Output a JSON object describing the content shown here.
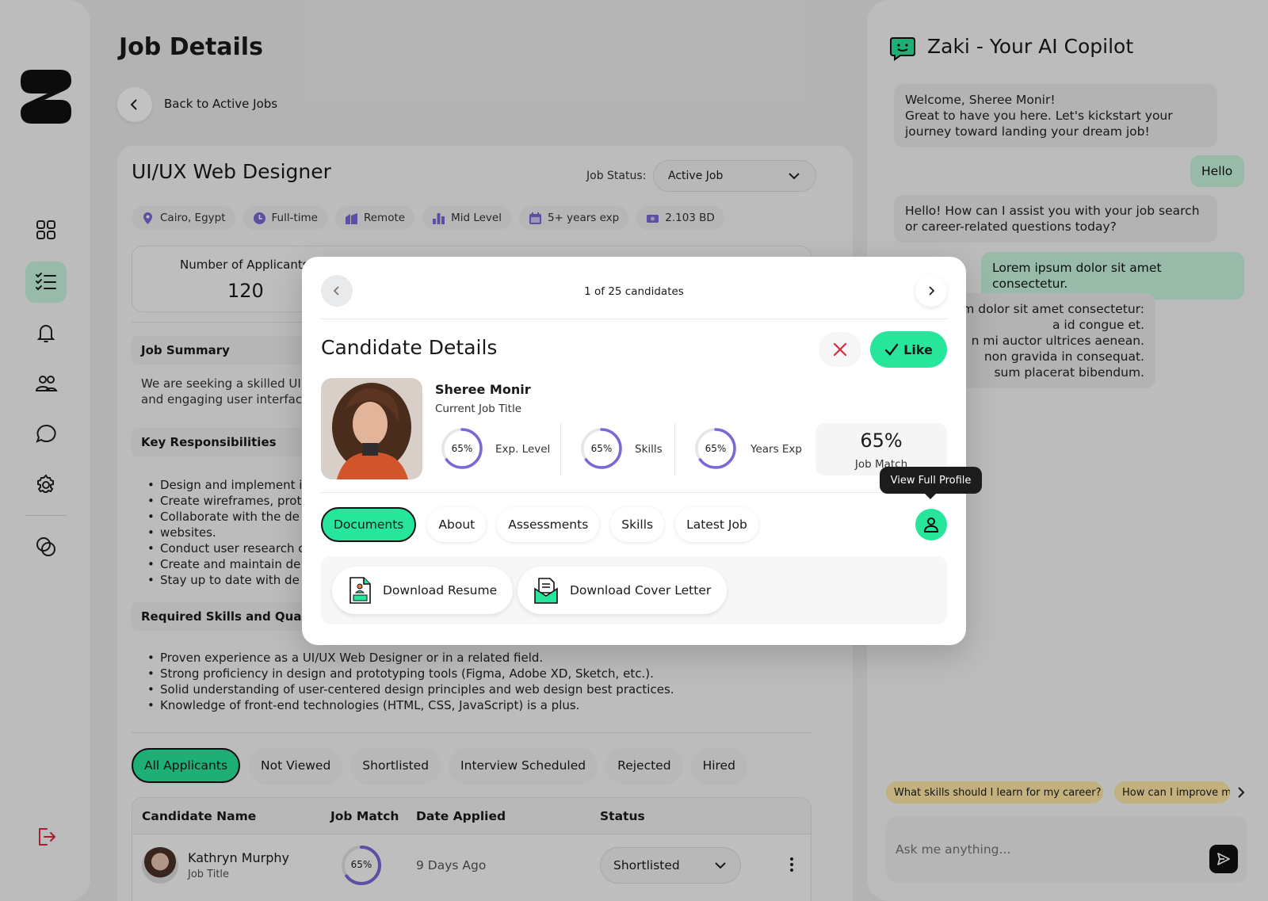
{
  "main": {
    "page_title": "Job Details",
    "back_label": "Back to Active Jobs",
    "job": {
      "title": "UI/UX Web Designer",
      "status_label": "Job Status:",
      "status_value": "Active Job",
      "chips": [
        {
          "icon": "location-pin-icon",
          "label": "Cairo, Egypt"
        },
        {
          "icon": "clock-icon",
          "label": "Full-time"
        },
        {
          "icon": "building-icon",
          "label": "Remote"
        },
        {
          "icon": "bar-chart-icon",
          "label": "Mid Level"
        },
        {
          "icon": "calendar-icon",
          "label": "5+ years exp"
        },
        {
          "icon": "money-icon",
          "label": "2.103 BD"
        }
      ],
      "applicants_label": "Number of Applicants",
      "applicants_value": "120",
      "summary_heading": "Job Summary",
      "summary_lines": [
        "We are seeking a skilled UI",
        "and engaging user interfac"
      ],
      "resp_heading": "Key Responsibilities",
      "responsibilities": [
        "Design and implement i",
        "Create wireframes, prot",
        "Collaborate with the de",
        "websites.",
        "Conduct user research c",
        "Create and maintain de",
        "Stay up to date with de"
      ],
      "skills_heading": "Required Skills and Qualif",
      "skills": [
        "Proven experience as a UI/UX Web Designer or in a related field.",
        "Strong proficiency in design and prototyping tools (Figma, Adobe XD, Sketch, etc.).",
        "Solid understanding of user-centered design principles and web design best practices.",
        "Knowledge of front-end technologies (HTML, CSS, JavaScript) is a plus."
      ]
    },
    "filters": [
      "All Applicants",
      "Not Viewed",
      "Shortlisted",
      "Interview Scheduled",
      "Rejected",
      "Hired"
    ],
    "table": {
      "headers": [
        "Candidate Name",
        "Job Match",
        "Date Applied",
        "Status"
      ],
      "rows": [
        {
          "name": "Kathryn Murphy",
          "subtitle": "Job Title",
          "match": "65%",
          "match_value": 0.65,
          "date": "9 Days Ago",
          "status": "Shortlisted"
        }
      ]
    }
  },
  "chat": {
    "title": "Zaki - Your AI Copilot",
    "messages": [
      {
        "from": "bot",
        "text": "Welcome, Sheree Monir!\nGreat to have you here. Let's kickstart your journey toward landing your dream job!"
      },
      {
        "from": "user",
        "text": "Hello"
      },
      {
        "from": "bot",
        "text": "Hello! How can I assist you with your job search or career-related questions today?"
      },
      {
        "from": "user",
        "text": "Lorem ipsum dolor sit amet consectetur."
      },
      {
        "from": "bot",
        "text": "um dolor sit amet consectetur:\na id congue et.\nn mi auctor ultrices aenean.\nnon gravida in consequat.\nsum placerat bibendum."
      }
    ],
    "suggestions": [
      "What skills should I learn for my career?",
      "How can I improve my"
    ],
    "input_placeholder": "Ask me anything..."
  },
  "modal": {
    "counter": "1 of 25 candidates",
    "title": "Candidate Details",
    "like_label": "Like",
    "candidate": {
      "name": "Sheree Monir",
      "job_title": "Current Job Title",
      "metrics": [
        {
          "pct": "65%",
          "value": 0.65,
          "label": "Exp. Level"
        },
        {
          "pct": "65%",
          "value": 0.65,
          "label": "Skills"
        },
        {
          "pct": "65%",
          "value": 0.65,
          "label": "Years Exp"
        }
      ],
      "job_match_value": "65%",
      "job_match_label": "Job Match"
    },
    "tooltip": "View Full Profile",
    "tabs": [
      "Documents",
      "About",
      "Assessments",
      "Skills",
      "Latest Job"
    ],
    "documents": [
      "Download Resume",
      "Download Cover Letter"
    ]
  },
  "colors": {
    "accent": "#27e69b",
    "ring": "#7b68d8",
    "suggestion_bg": "#ffe8a6",
    "reject_red": "#e0293f"
  }
}
